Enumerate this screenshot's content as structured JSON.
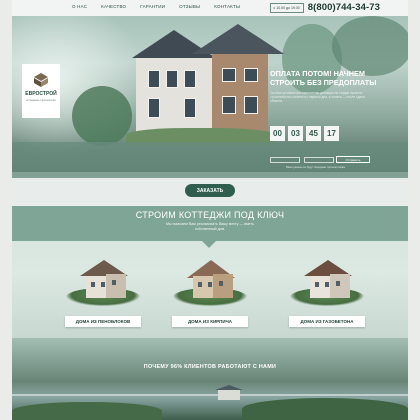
{
  "nav": {
    "items": [
      "О НАС",
      "КАЧЕСТВО",
      "ГАРАНТИИ",
      "ОТЗЫВЫ",
      "КОНТАКТЫ"
    ],
    "hours": "с 10.00 до 19.00",
    "phone": "8(800)744-34-73"
  },
  "logo": {
    "name": "ЕВРОСТРОЙ",
    "tagline": "коттеджное строительство"
  },
  "hero": {
    "offer_title": "ОПЛАТА ПОТОМ! НАЧНЕМ СТРОИТЬ БЕЗ ПРЕДОПЛАТЫ",
    "offer_text": "Особые условия при заключении договора на стадии проекта: строительство начнется с первого дня, а оплата — после сдачи объекта.",
    "timer": [
      "00",
      "03",
      "45",
      "17"
    ],
    "form_button": "Отправить",
    "form_note": "Ваши данные не будут переданы третьим лицам"
  },
  "order_button": "ЗАКАЗАТЬ",
  "build": {
    "title": "СТРОИМ КОТТЕДЖИ ПОД КЛЮЧ",
    "subtitle": "Мы поможем Вам реализовать Вашу мечту — иметь собственный дом.",
    "cards": [
      {
        "label": "ДОМА ИЗ ПЕНОБЛОКОВ"
      },
      {
        "label": "ДОМА ИЗ КИРПИЧА"
      },
      {
        "label": "ДОМА ИЗ ГАЗОБЕТОНА"
      }
    ]
  },
  "why": "ПОЧЕМУ 96% КЛИЕНТОВ РАБОТАЮТ С НАМИ",
  "colors": {
    "accent": "#2f5e4e",
    "section": "#7fa596",
    "strip": "#688c7e"
  }
}
